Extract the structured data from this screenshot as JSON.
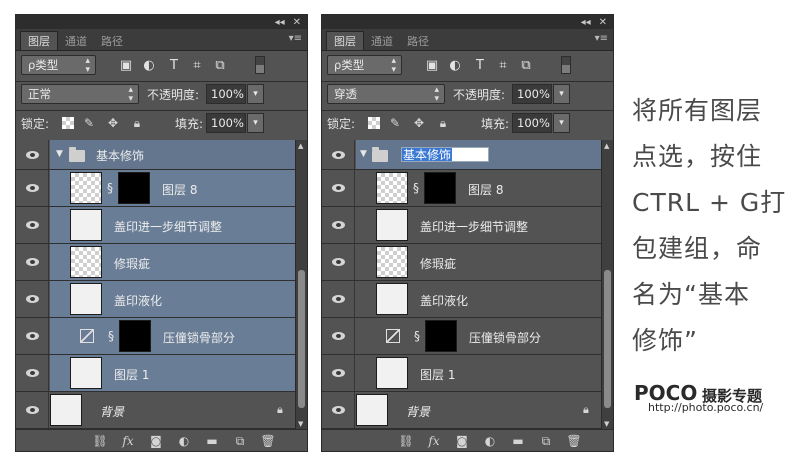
{
  "panels": [
    {
      "tabs": [
        "图层",
        "通道",
        "路径"
      ],
      "filter": {
        "label": "ρ类型"
      },
      "blend_mode": "正常",
      "opacity": {
        "label": "不透明度:",
        "value": "100%"
      },
      "lock": {
        "label": "锁定:"
      },
      "fill": {
        "label": "填充:",
        "value": "100%"
      },
      "group_name": "基本修饰",
      "layers": [
        {
          "name": "图层 8"
        },
        {
          "name": "盖印进一步细节调整"
        },
        {
          "name": "修瑕疵"
        },
        {
          "name": "盖印液化"
        },
        {
          "name": "压僮锁骨部分"
        },
        {
          "name": "图层 1"
        },
        {
          "name": "背景"
        }
      ]
    },
    {
      "tabs": [
        "图层",
        "通道",
        "路径"
      ],
      "filter": {
        "label": "ρ类型"
      },
      "blend_mode": "穿透",
      "opacity": {
        "label": "不透明度:",
        "value": "100%"
      },
      "lock": {
        "label": "锁定:"
      },
      "fill": {
        "label": "填充:",
        "value": "100%"
      },
      "group_name": "基本修饰",
      "layers": [
        {
          "name": "图层 8"
        },
        {
          "name": "盖印进一步细节调整"
        },
        {
          "name": "修瑕疵"
        },
        {
          "name": "盖印液化"
        },
        {
          "name": "压僮锁骨部分"
        },
        {
          "name": "图层 1"
        },
        {
          "name": "背景"
        }
      ]
    }
  ],
  "caption": {
    "lines": [
      "将所有图层",
      "点选，按住",
      "CTRL + G打",
      "包建组，命",
      "名为“基本",
      "修饰”"
    ]
  },
  "logo": {
    "brand": "POCO",
    "sub": "摄影专题",
    "url": "http://photo.poco.cn/"
  },
  "colors": {
    "panel_bg": "#535353",
    "selected_row": "#63768e",
    "rename_highlight": "#3a78d4",
    "caption_text": "#4a4a4a"
  }
}
